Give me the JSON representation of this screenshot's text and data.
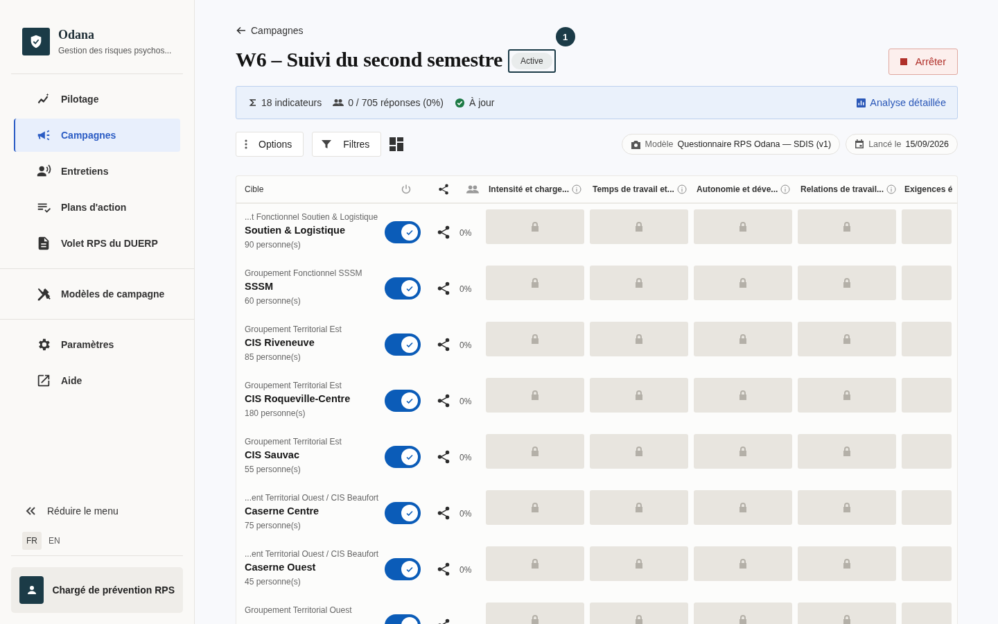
{
  "brand": {
    "name": "Odana",
    "subtitle": "Gestion des risques psychos..."
  },
  "nav_groups": [
    [
      {
        "label": "Pilotage",
        "selected": false
      },
      {
        "label": "Campagnes",
        "selected": true
      },
      {
        "label": "Entretiens",
        "selected": false
      },
      {
        "label": "Plans d'action",
        "selected": false
      },
      {
        "label": "Volet RPS du DUERP",
        "selected": false
      }
    ],
    [
      {
        "label": "Modèles de campagne",
        "selected": false
      }
    ],
    [
      {
        "label": "Paramètres",
        "selected": false
      },
      {
        "label": "Aide",
        "selected": false
      }
    ]
  ],
  "collapse": "Réduire le menu",
  "languages": [
    {
      "label": "FR",
      "selected": true
    },
    {
      "label": "EN",
      "selected": false
    }
  ],
  "user": {
    "role": "Chargé de prévention RPS"
  },
  "back_link": "Campagnes",
  "title": "W6 – Suivi du second semestre",
  "status": "Active",
  "badge": "1",
  "stop_button": "Arrêter",
  "summary": {
    "indicators": "18 indicateurs",
    "responses": "0 / 705 réponses (0%)",
    "sync": "À jour",
    "analysis_link": "Analyse détaillée"
  },
  "toolbar": {
    "options": "Options",
    "filters": "Filtres"
  },
  "meta": [
    {
      "kind": "model",
      "label": "Modèle",
      "value": "Questionnaire RPS Odana — SDIS (v1)"
    },
    {
      "kind": "date",
      "label": "Lancé le",
      "value": "15/09/2026"
    }
  ],
  "table": {
    "columns": [
      "Cible",
      "Intensité et charge...",
      "Temps de travail et...",
      "Autonomie et déve...",
      "Relations de travail...",
      "Exigences é"
    ],
    "rows": [
      {
        "parent": "...t Fonctionnel Soutien & Logistique",
        "name": "Soutien & Logistique",
        "count": "90 personne(s)",
        "enabled": true,
        "percent": "0%",
        "locked": true
      },
      {
        "parent": "Groupement Fonctionnel SSSM",
        "name": "SSSM",
        "count": "60 personne(s)",
        "enabled": true,
        "percent": "0%",
        "locked": true
      },
      {
        "parent": "Groupement Territorial Est",
        "name": "CIS Riveneuve",
        "count": "85 personne(s)",
        "enabled": true,
        "percent": "0%",
        "locked": true
      },
      {
        "parent": "Groupement Territorial Est",
        "name": "CIS Roqueville-Centre",
        "count": "180 personne(s)",
        "enabled": true,
        "percent": "0%",
        "locked": true
      },
      {
        "parent": "Groupement Territorial Est",
        "name": "CIS Sauvac",
        "count": "55 personne(s)",
        "enabled": true,
        "percent": "0%",
        "locked": true
      },
      {
        "parent": "...ent Territorial Ouest / CIS Beaufort",
        "name": "Caserne Centre",
        "count": "75 personne(s)",
        "enabled": true,
        "percent": "0%",
        "locked": true
      },
      {
        "parent": "...ent Territorial Ouest / CIS Beaufort",
        "name": "Caserne Ouest",
        "count": "45 personne(s)",
        "enabled": true,
        "percent": "0%",
        "locked": true
      },
      {
        "parent": "Groupement Territorial Ouest",
        "enabled": true,
        "locked": true
      }
    ]
  }
}
